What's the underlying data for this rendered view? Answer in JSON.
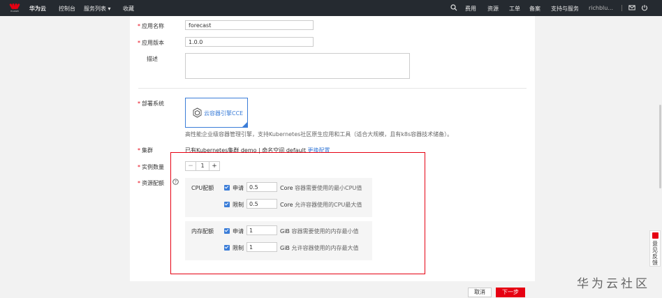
{
  "topbar": {
    "logo_sub": "HUAWEI",
    "brand": "华为云",
    "console": "控制台",
    "service_list": "服务列表",
    "favorites": "收藏",
    "fees": "费用",
    "resources": "资源",
    "ticket": "工单",
    "record": "备案",
    "support": "支持与服务",
    "user": "richblu...",
    "dropdown_caret": "▾"
  },
  "form": {
    "app_name_label": "应用名称",
    "app_name_value": "forecast",
    "app_version_label": "应用版本",
    "app_version_value": "1.0.0",
    "description_label": "描述",
    "description_value": "",
    "deploy_system_label": "部署系统",
    "deploy_card_label": "云容器引擎CCE",
    "deploy_desc": "高性能企业级容器管理引擎，支持Kubernetes社区原生应用和工具（适合大规模，且有k8s容器技术储备）。",
    "cluster_label": "集群",
    "cluster_text": "已有Kubernetes集群 demo | 命名空间 default",
    "cluster_link": "更换配置",
    "instances_label": "实例数量",
    "instances_minus": "−",
    "instances_value": "1",
    "instances_plus": "+",
    "resource_quota_label": "资源配额",
    "help_icon_glyph": "?",
    "required_mark": "*"
  },
  "cpu": {
    "title": "CPU配额",
    "request_label": "申请",
    "request_value": "0.5",
    "request_unit": "Core",
    "request_desc": "容器需要使用的最小CPU值",
    "limit_label": "限制",
    "limit_value": "0.5",
    "limit_unit": "Core",
    "limit_desc": "允许容器使用的CPU最大值"
  },
  "memory": {
    "title": "内存配额",
    "request_label": "申请",
    "request_value": "1",
    "request_unit": "GiB",
    "request_desc": "容器需要使用的内存最小值",
    "limit_label": "限制",
    "limit_value": "1",
    "limit_unit": "GiB",
    "limit_desc": "允许容器使用的内存最大值"
  },
  "actions": {
    "cancel": "取消",
    "next": "下一步"
  },
  "feedback": {
    "label": "意见反馈"
  },
  "watermark": "华为云社区",
  "colors": {
    "brand_red": "#e60012",
    "link_blue": "#3b7dd8",
    "topbar_bg": "#252a30"
  }
}
